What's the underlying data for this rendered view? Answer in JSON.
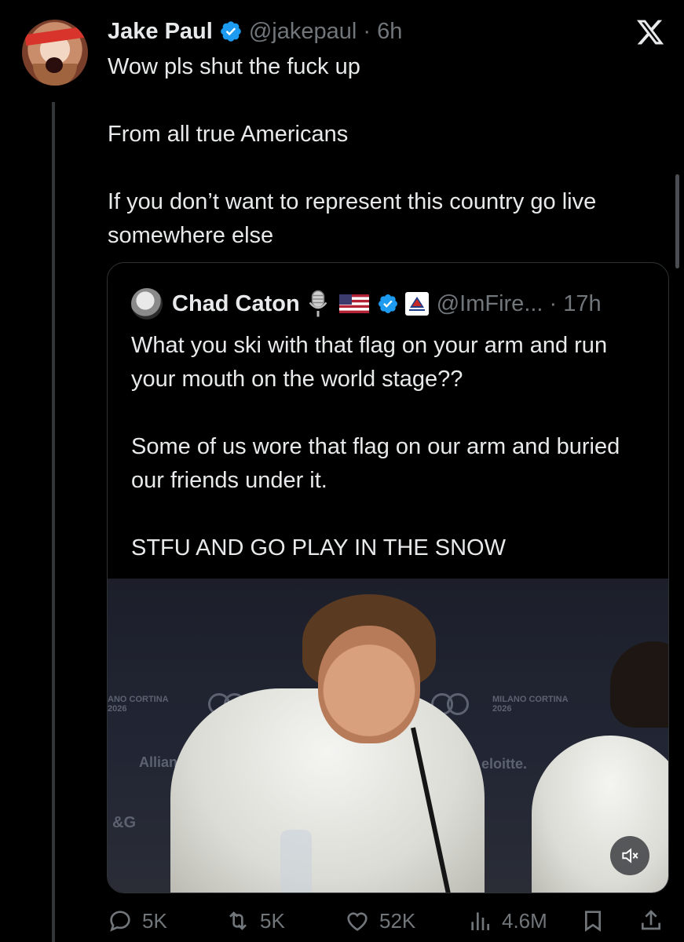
{
  "tweet": {
    "author_name": "Jake Paul",
    "handle_time": "@jakepaul · 6h",
    "lines": [
      "Wow pls shut the fuck up",
      "",
      "From all true Americans",
      "",
      "If you don’t want to represent this country go live somewhere else"
    ]
  },
  "quote": {
    "author_name": "Chad Caton",
    "handle_time": "@ImFire... · 17h",
    "lines": [
      "What you ski with that flag on your arm and run your mouth on the world stage??",
      "",
      "Some of us wore that flag on our arm and buried our friends under it.",
      "",
      "STFU AND GO PLAY IN THE SNOW"
    ],
    "media": {
      "backdrop_left": "ANO CORTINA\n2026",
      "backdrop_right": "MILANO CORTINA\n2026",
      "sponsor_left": "Allianz",
      "sponsor_right": "eloitte.",
      "sponsor_edge": "&G"
    }
  },
  "actions": {
    "replies": "5K",
    "reposts": "5K",
    "likes": "52K",
    "views": "4.6M"
  },
  "colors": {
    "background": "#000000",
    "text": "#e7e9ea",
    "secondary": "#71767b",
    "verified": "#1d9bf0",
    "border": "#2f3336"
  },
  "icons": [
    "x-logo-icon",
    "verified-icon",
    "microphone-icon",
    "us-flag-icon",
    "reply-icon",
    "repost-icon",
    "like-icon",
    "views-icon",
    "bookmark-icon",
    "share-icon",
    "mute-icon"
  ]
}
